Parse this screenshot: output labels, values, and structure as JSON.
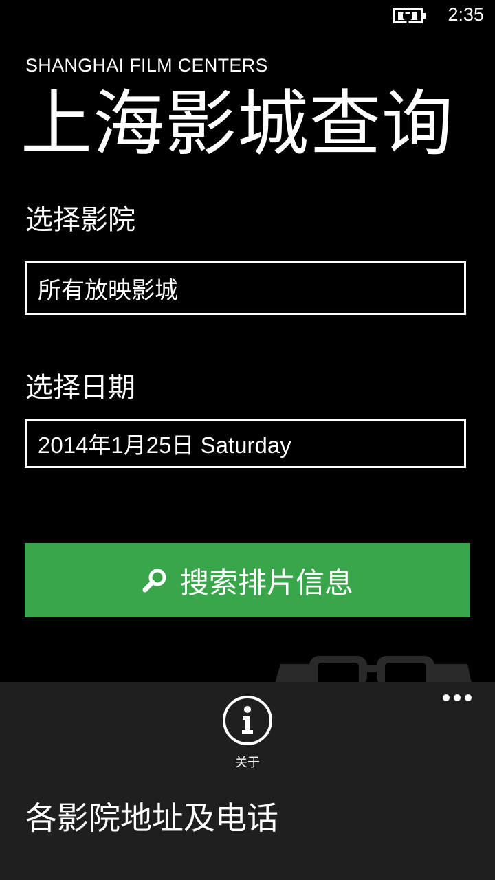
{
  "status_bar": {
    "time": "2:35"
  },
  "app": {
    "title": "SHANGHAI FILM CENTERS",
    "page_title": "上海影城查询"
  },
  "form": {
    "cinema_label": "选择影院",
    "cinema_value": "所有放映影城",
    "date_label": "选择日期",
    "date_value": "2014年1月25日 Saturday",
    "search_label": "搜索排片信息"
  },
  "app_bar": {
    "about_label": "关于",
    "menu_items": [
      "各影院地址及电话"
    ]
  },
  "colors": {
    "accent": "#3aa64c",
    "background": "#000000",
    "app_bar": "#1f1f1f"
  }
}
